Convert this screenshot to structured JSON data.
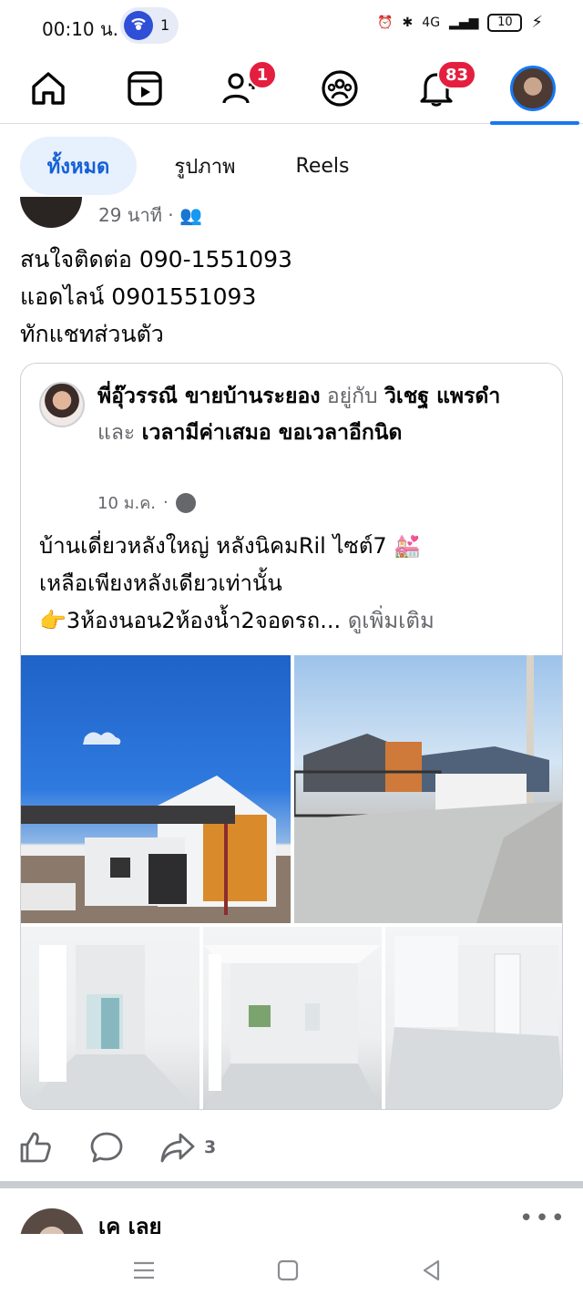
{
  "status_bar": {
    "time": "00:10 น.",
    "hotspot_count": "1",
    "network": "4G",
    "battery": "10"
  },
  "nav": {
    "items": [
      {
        "icon": "home-icon"
      },
      {
        "icon": "video-icon"
      },
      {
        "icon": "friends-icon",
        "badge": "1"
      },
      {
        "icon": "groups-icon"
      },
      {
        "icon": "bell-icon",
        "badge": "83"
      },
      {
        "icon": "profile-avatar"
      }
    ],
    "accent": "#1877f2",
    "badge_color": "#e41e3f"
  },
  "filters": [
    "ทั้งหมด",
    "รูปภาพ",
    "Reels"
  ],
  "post": {
    "time": "29 นาที",
    "body": [
      "สนใจติดต่อ 090-1551093",
      "แอดไลน์ 0901551093",
      "ทักแชทส่วนตัว"
    ]
  },
  "shared": {
    "author": "พี่อุ๊วรรณี ขายบ้านระยอง",
    "with_text": "อยู่กับ",
    "tag1": "วิเชฐ แพรดำ",
    "and_text": "และ",
    "tag2": "เวลามีค่าเสมอ ขอเวลาอีกนิด",
    "time": "10 ม.ค.",
    "text_line1": "บ้านเดี่ยวหลังใหญ่ หลังนิคมRil ไซต์7 💒",
    "text_line2": "เหลือเพียงหลังเดียวเท่านั้น",
    "text_line3": "👉3ห้องนอน2ห้องน้ำ2จอดรถ...",
    "see_more": "ดูเพิ่มเติม"
  },
  "actions": {
    "share_count": "3"
  },
  "next_post": {
    "author": "เค เลย",
    "menu": "•••"
  }
}
